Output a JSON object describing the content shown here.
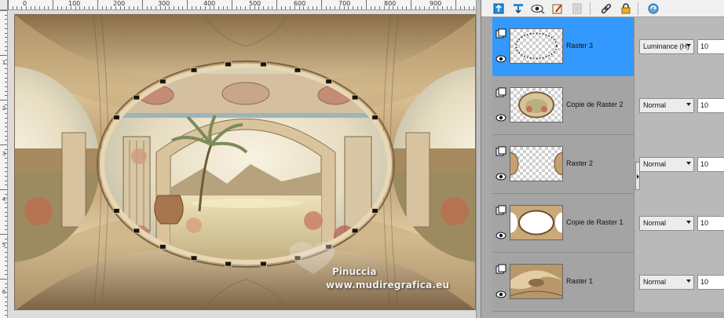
{
  "rulers": {
    "horizontal": [
      "0",
      "100",
      "200",
      "300",
      "400",
      "500",
      "600",
      "700",
      "800",
      "900"
    ],
    "vertical": [
      "1",
      "2",
      "3",
      "4",
      "5",
      "6"
    ]
  },
  "canvas": {
    "watermark_name": "Pinuccia",
    "watermark_url": "www.mudiregrafica.eu"
  },
  "toolbar": {
    "icons": [
      "new-layer-icon",
      "merge-down-icon",
      "visibility-icon",
      "properties-icon",
      "mask-icon",
      "link-icon",
      "lock-icon",
      "sync-icon"
    ]
  },
  "layers": [
    {
      "name": "Raster 3",
      "blend_mode": "Luminance (H)",
      "opacity": "10",
      "selected": true,
      "thumbnail": "dotted-oval"
    },
    {
      "name": "Copie de Raster 2",
      "blend_mode": "Normal",
      "opacity": "10",
      "selected": false,
      "thumbnail": "scene-oval"
    },
    {
      "name": "Raster 2",
      "blend_mode": "Normal",
      "opacity": "10",
      "selected": false,
      "thumbnail": "side-halves"
    },
    {
      "name": "Copie de Raster 1",
      "blend_mode": "Normal",
      "opacity": "10",
      "selected": false,
      "thumbnail": "frame-ring"
    },
    {
      "name": "Raster 1",
      "blend_mode": "Normal",
      "opacity": "10",
      "selected": false,
      "thumbnail": "swirl"
    }
  ],
  "colors": {
    "selected_layer": "#3399ff",
    "palette_bg": "#a8a8a8",
    "artwork_gold": "#c8aa78"
  }
}
